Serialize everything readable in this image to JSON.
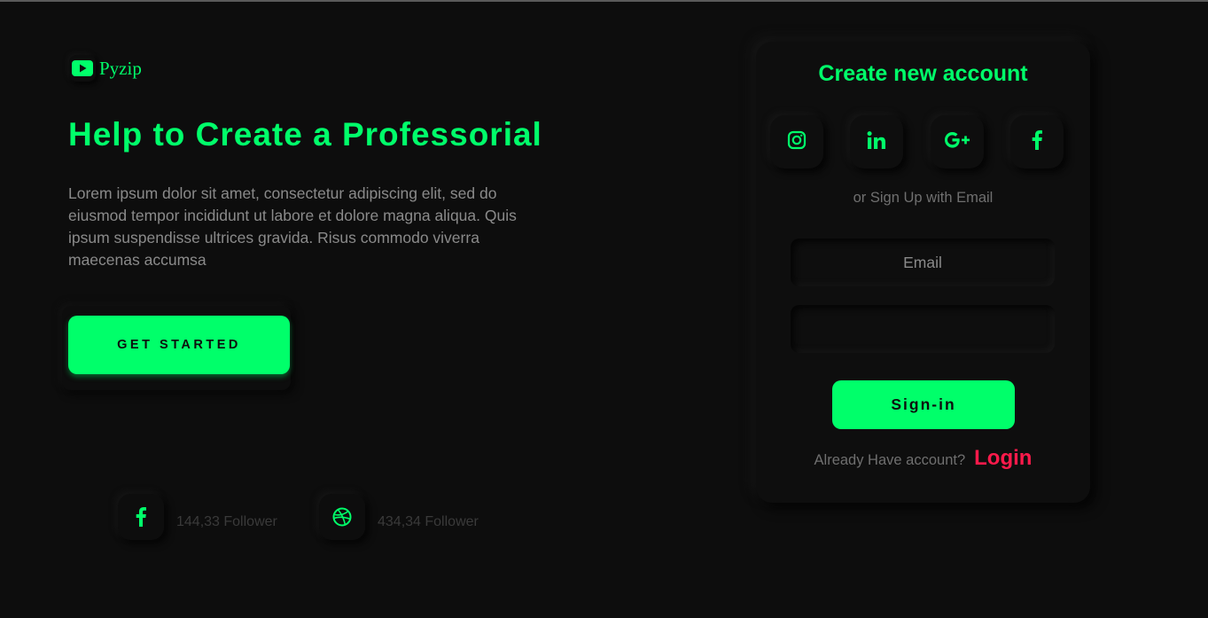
{
  "brand": {
    "name": "Pyzip",
    "icon": "youtube-icon"
  },
  "hero": {
    "title": "Help to Create a Professorial",
    "text": "Lorem ipsum dolor sit amet, consectetur adipiscing elit, sed do eiusmod tempor incididunt ut labore et dolore magna aliqua. Quis ipsum suspendisse ultrices gravida. Risus commodo viverra maecenas accumsa",
    "cta_label": "GET STARTED"
  },
  "followers": [
    {
      "icon": "facebook-icon",
      "count": "144,33 Follower"
    },
    {
      "icon": "dribbble-icon",
      "count": "434,34 Follower"
    }
  ],
  "signup": {
    "title": "Create new account",
    "social": [
      "instagram-icon",
      "linkedin-icon",
      "google-plus-icon",
      "facebook-icon"
    ],
    "divider": "or Sign Up with Email",
    "email_placeholder": "Email",
    "password_placeholder": "",
    "submit_label": "Sign-in",
    "login_prompt": "Already Have account?",
    "login_label": "Login"
  },
  "colors": {
    "accent": "#00ff6a",
    "background": "#0d0d0d",
    "login": "#ff1a4b",
    "muted_text": "#8a8a8a"
  }
}
